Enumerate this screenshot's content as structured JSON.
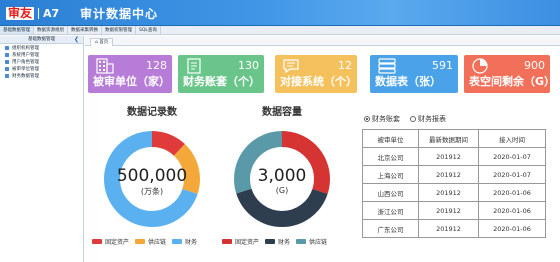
{
  "header": {
    "brand": "审友",
    "model": "A7",
    "title": "审计数据中心"
  },
  "nav": [
    "基础数据管理",
    "数据资源规划",
    "数据采集转换",
    "数据权限管理",
    "SQL查询"
  ],
  "sidebar": {
    "title": "基础数据管理",
    "collapse_glyph": "❮",
    "items": [
      "组织机构管理",
      "系统用户管理",
      "用户角色管理",
      "被审单位管理",
      "财务数据管理"
    ]
  },
  "tabs": {
    "home": "首页"
  },
  "kpis": [
    {
      "value": "128",
      "label": "被审单位（家）",
      "color": "#b77bd8",
      "icon": "building-icon"
    },
    {
      "value": "130",
      "label": "财务账套（个）",
      "color": "#6ac58a",
      "icon": "ledger-icon"
    },
    {
      "value": "12",
      "label": "对接系统（个）",
      "color": "#f5c15d",
      "icon": "message-icon"
    },
    {
      "value": "591",
      "label": "数据表（张）",
      "color": "#4aa2e8",
      "icon": "database-icon"
    },
    {
      "value": "900",
      "label": "表空间剩余（G）",
      "color": "#f2705a",
      "icon": "pie-icon"
    }
  ],
  "records": {
    "title": "数据记录数",
    "value": "500,000",
    "unit": "(万条)"
  },
  "capacity": {
    "title": "数据容量",
    "value": "3,000",
    "unit": "(G)"
  },
  "chart_data": [
    {
      "type": "pie",
      "title": "数据记录数",
      "series": [
        {
          "name": "固定资产",
          "value": 12,
          "color": "#e03b3b"
        },
        {
          "name": "供应链",
          "value": 18,
          "color": "#f5a83a"
        },
        {
          "name": "财务",
          "value": 70,
          "color": "#5bb0f0"
        }
      ]
    },
    {
      "type": "pie",
      "title": "数据容量",
      "series": [
        {
          "name": "固定资产",
          "value": 30,
          "color": "#d63333"
        },
        {
          "name": "财务",
          "value": 40,
          "color": "#2e3e4e"
        },
        {
          "name": "供应链",
          "value": 30,
          "color": "#5a9aa8"
        }
      ]
    }
  ],
  "legend1": [
    {
      "name": "固定资产",
      "color": "#e03b3b"
    },
    {
      "name": "供应链",
      "color": "#f5a83a"
    },
    {
      "name": "财务",
      "color": "#5bb0f0"
    }
  ],
  "legend2": [
    {
      "name": "固定资产",
      "color": "#d63333"
    },
    {
      "name": "财务",
      "color": "#2e3e4e"
    },
    {
      "name": "供应链",
      "color": "#5a9aa8"
    }
  ],
  "radios": [
    {
      "label": "财务账套",
      "checked": true
    },
    {
      "label": "财务报表",
      "checked": false
    }
  ],
  "table": {
    "headers": [
      "被审单位",
      "最新数据期间",
      "接入时间"
    ],
    "rows": [
      [
        "北京公司",
        "201912",
        "2020-01-07"
      ],
      [
        "上海公司",
        "201912",
        "2020-01-07"
      ],
      [
        "山西公司",
        "201912",
        "2020-01-06"
      ],
      [
        "浙江公司",
        "201912",
        "2020-01-06"
      ],
      [
        "广东公司",
        "201912",
        "2020-01-06"
      ]
    ]
  }
}
